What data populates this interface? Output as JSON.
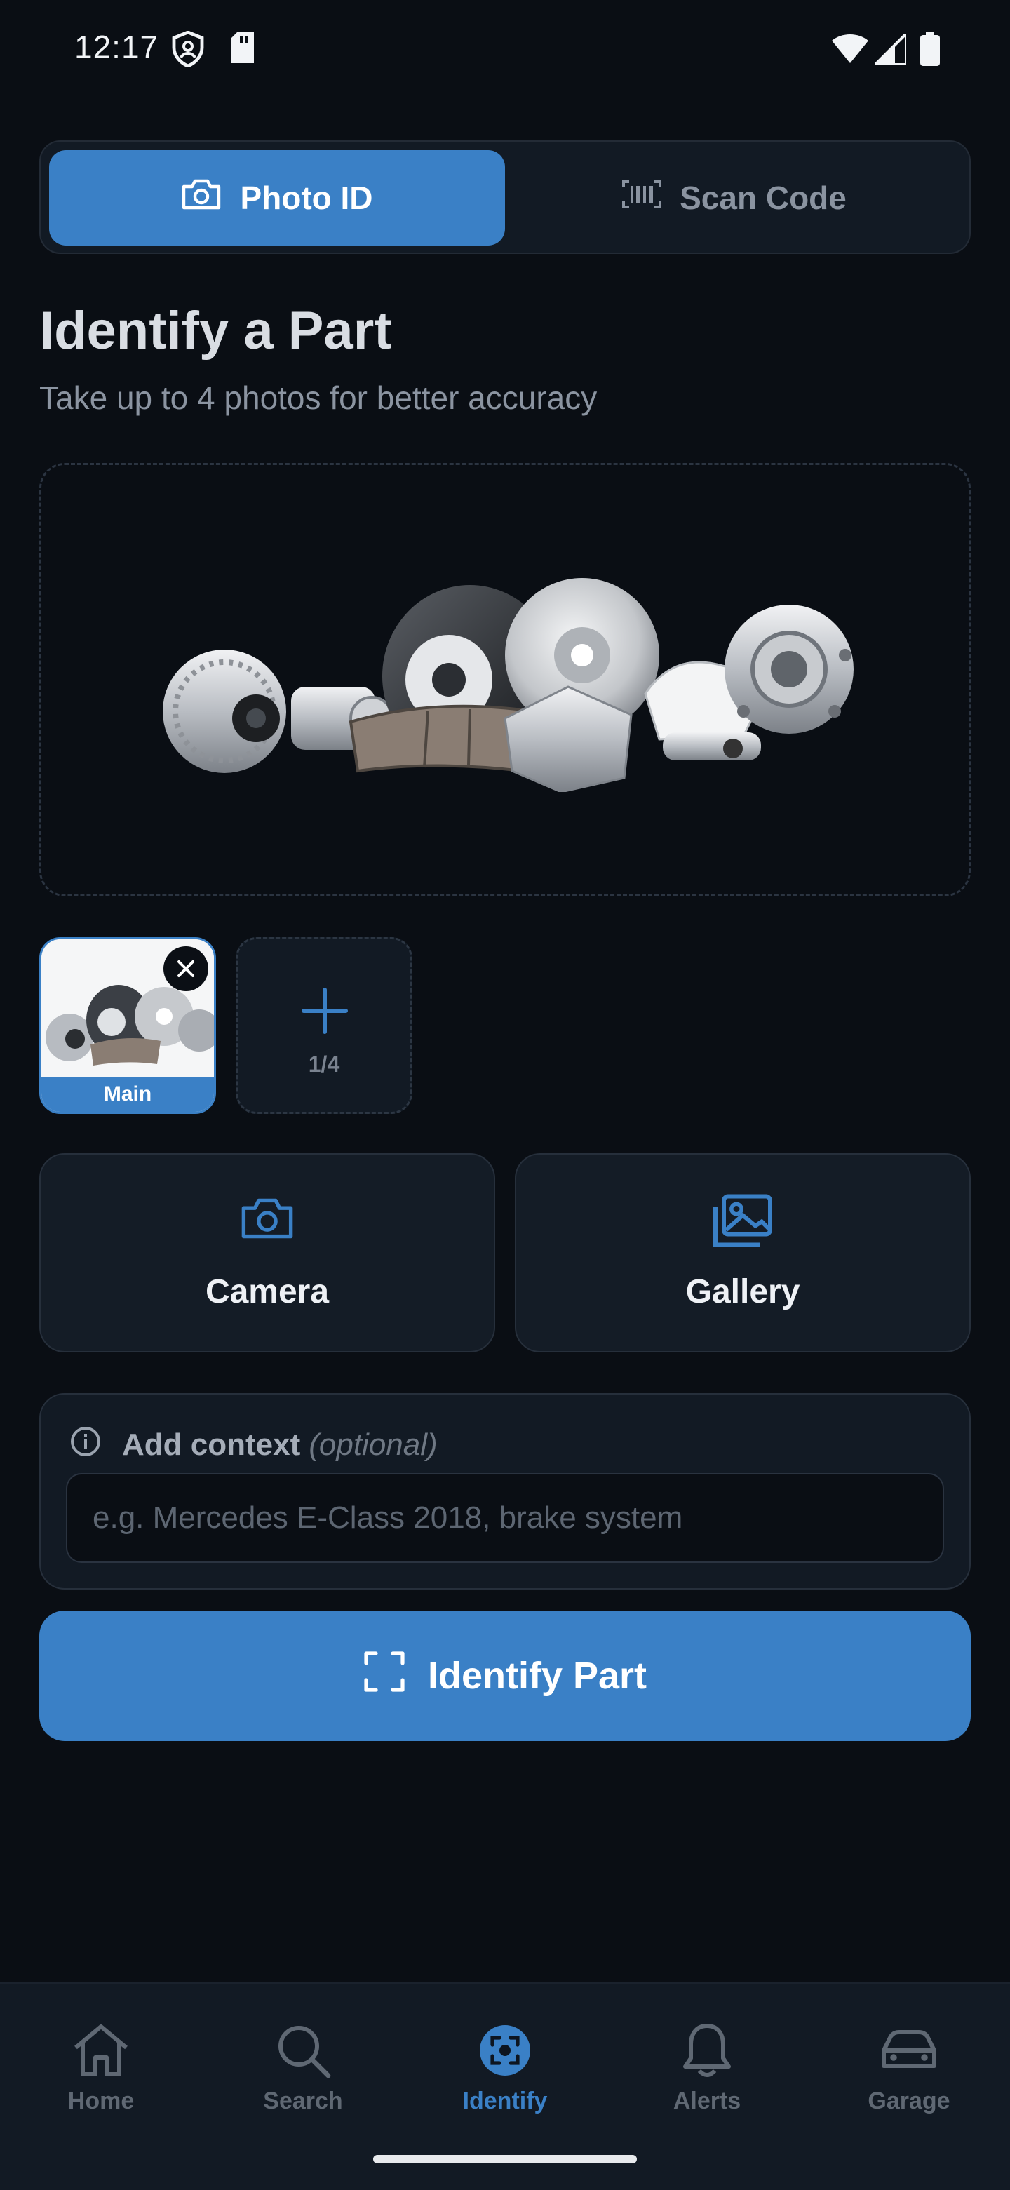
{
  "status_bar": {
    "time": "12:17"
  },
  "mode_tabs": {
    "photo_id": "Photo ID",
    "scan_code": "Scan Code"
  },
  "header": {
    "title": "Identify a Part",
    "subtitle": "Take up to 4 photos for better accuracy"
  },
  "photos": {
    "main_label": "Main",
    "count": "1/4"
  },
  "sources": {
    "camera": "Camera",
    "gallery": "Gallery"
  },
  "context": {
    "label": "Add context",
    "optional": "(optional)",
    "placeholder": "e.g. Mercedes E-Class 2018, brake system",
    "value": ""
  },
  "action": {
    "identify": "Identify Part"
  },
  "nav": {
    "items": [
      {
        "label": "Home",
        "icon": "home-icon"
      },
      {
        "label": "Search",
        "icon": "search-icon"
      },
      {
        "label": "Identify",
        "icon": "identify-icon"
      },
      {
        "label": "Alerts",
        "icon": "bell-icon"
      },
      {
        "label": "Garage",
        "icon": "car-icon"
      }
    ],
    "active_index": 2
  },
  "colors": {
    "accent": "#3a80c6",
    "background": "#0a0e14",
    "card": "#121a24"
  }
}
